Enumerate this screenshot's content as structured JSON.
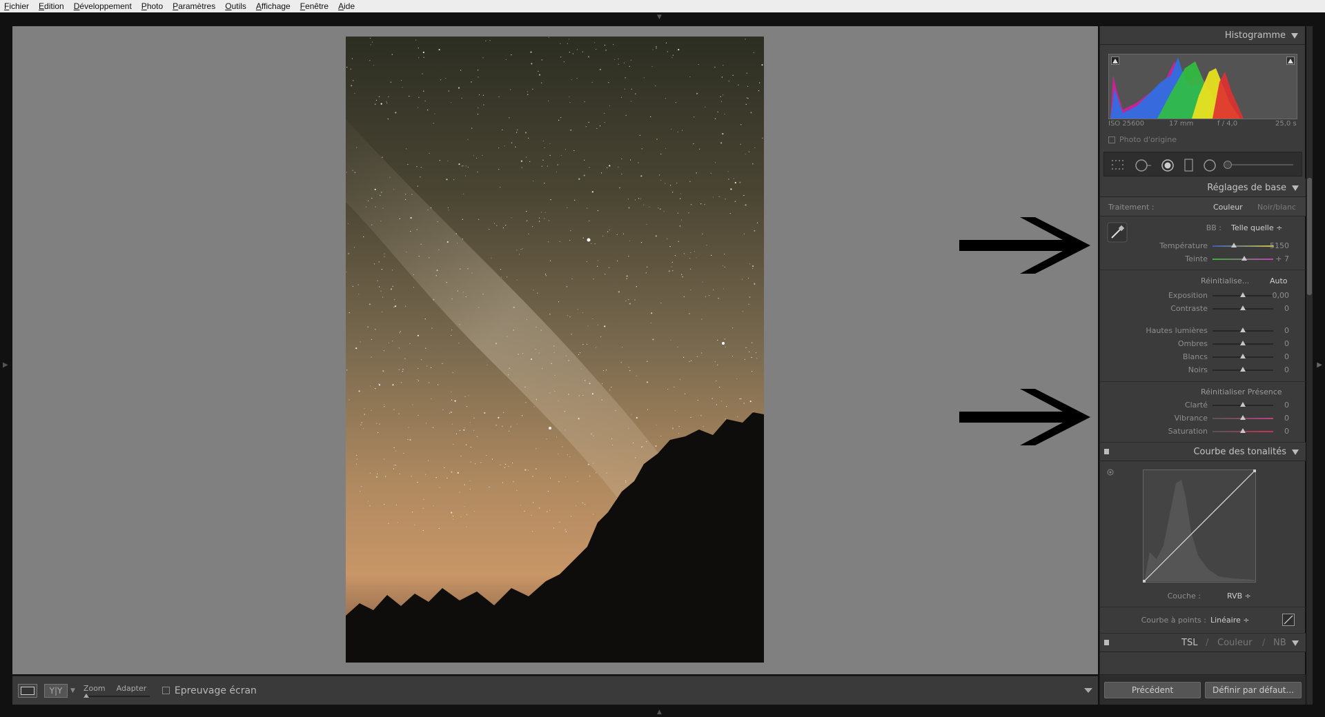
{
  "menu": [
    "Fichier",
    "Edition",
    "Développement",
    "Photo",
    "Paramètres",
    "Outils",
    "Affichage",
    "Fenêtre",
    "Aide"
  ],
  "toolbar": {
    "yy_label": "Y|Y",
    "zoom_label": "Zoom",
    "fit_label": "Adapter",
    "softproof_label": "Epreuvage écran"
  },
  "histogram": {
    "title": "Histogramme",
    "iso": "ISO 25600",
    "focal": "17 mm",
    "aperture": "f / 4,0",
    "shutter": "25,0 s",
    "original_photo_label": "Photo d'origine"
  },
  "basic": {
    "title": "Réglages de base",
    "treatment_label": "Traitement :",
    "color_label": "Couleur",
    "bw_label": "Noir/blanc",
    "wb_label": "BB :",
    "wb_value": "Telle quelle ÷",
    "temperature": {
      "label": "Température",
      "value": "5150",
      "position": 0.35
    },
    "tint": {
      "label": "Teinte",
      "value": "+ 7",
      "position": 0.52
    },
    "reset_label": "Réinitialise...",
    "auto_label": "Auto",
    "exposure": {
      "label": "Exposition",
      "value": "0,00",
      "position": 0.5
    },
    "contrast": {
      "label": "Contraste",
      "value": "0",
      "position": 0.5
    },
    "highlights": {
      "label": "Hautes lumières",
      "value": "0",
      "position": 0.5
    },
    "shadows": {
      "label": "Ombres",
      "value": "0",
      "position": 0.5
    },
    "whites": {
      "label": "Blancs",
      "value": "0",
      "position": 0.5
    },
    "blacks": {
      "label": "Noirs",
      "value": "0",
      "position": 0.5
    },
    "reset_presence_label": "Réinitialiser Présence",
    "clarity": {
      "label": "Clarté",
      "value": "0",
      "position": 0.5
    },
    "vibrance": {
      "label": "Vibrance",
      "value": "0",
      "position": 0.5
    },
    "saturation": {
      "label": "Saturation",
      "value": "0",
      "position": 0.5
    }
  },
  "tone_curve": {
    "title": "Courbe des tonalités",
    "channel_label": "Couche :",
    "channel_value": "RVB ÷",
    "point_curve_label": "Courbe à points :",
    "point_curve_value": "Linéaire ÷"
  },
  "hsl": {
    "tsl": "TSL",
    "sep": "/",
    "color": "Couleur",
    "nb": "NB"
  },
  "footer": {
    "previous_label": "Précédent",
    "default_label": "Définir par défaut..."
  },
  "colors": {
    "accent": "#c4c4c4",
    "panel": "#3b3b3b",
    "canvas": "#808080"
  }
}
